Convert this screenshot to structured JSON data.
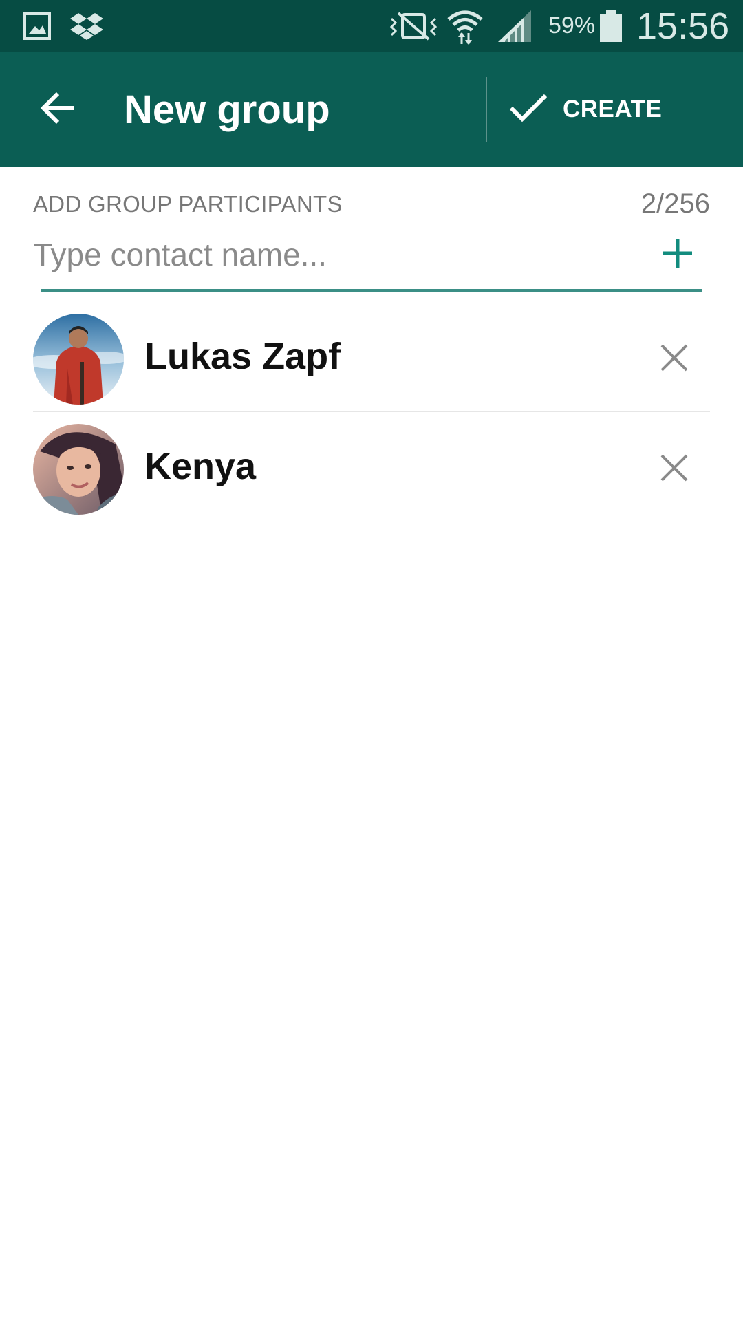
{
  "status_bar": {
    "battery_percent": "59%",
    "time": "15:56",
    "icons": [
      "gallery-icon",
      "dropbox-icon",
      "vibrate-icon",
      "wifi-icon",
      "signal-icon",
      "battery-icon"
    ]
  },
  "app_bar": {
    "title": "New group",
    "create_label": "CREATE",
    "back_icon": "arrow-back-icon",
    "create_icon": "checkmark-icon"
  },
  "participants": {
    "section_label": "ADD GROUP PARTICIPANTS",
    "count": "2/256",
    "search_placeholder": "Type contact name...",
    "search_value": "",
    "add_icon": "plus-icon"
  },
  "contacts": [
    {
      "name": "Lukas Zapf",
      "remove_icon": "close-icon"
    },
    {
      "name": "Kenya",
      "remove_icon": "close-icon"
    }
  ],
  "colors": {
    "status_bar": "#064c43",
    "app_bar": "#0b5e54",
    "accent": "#128c7e",
    "underline": "#3b8f86"
  }
}
